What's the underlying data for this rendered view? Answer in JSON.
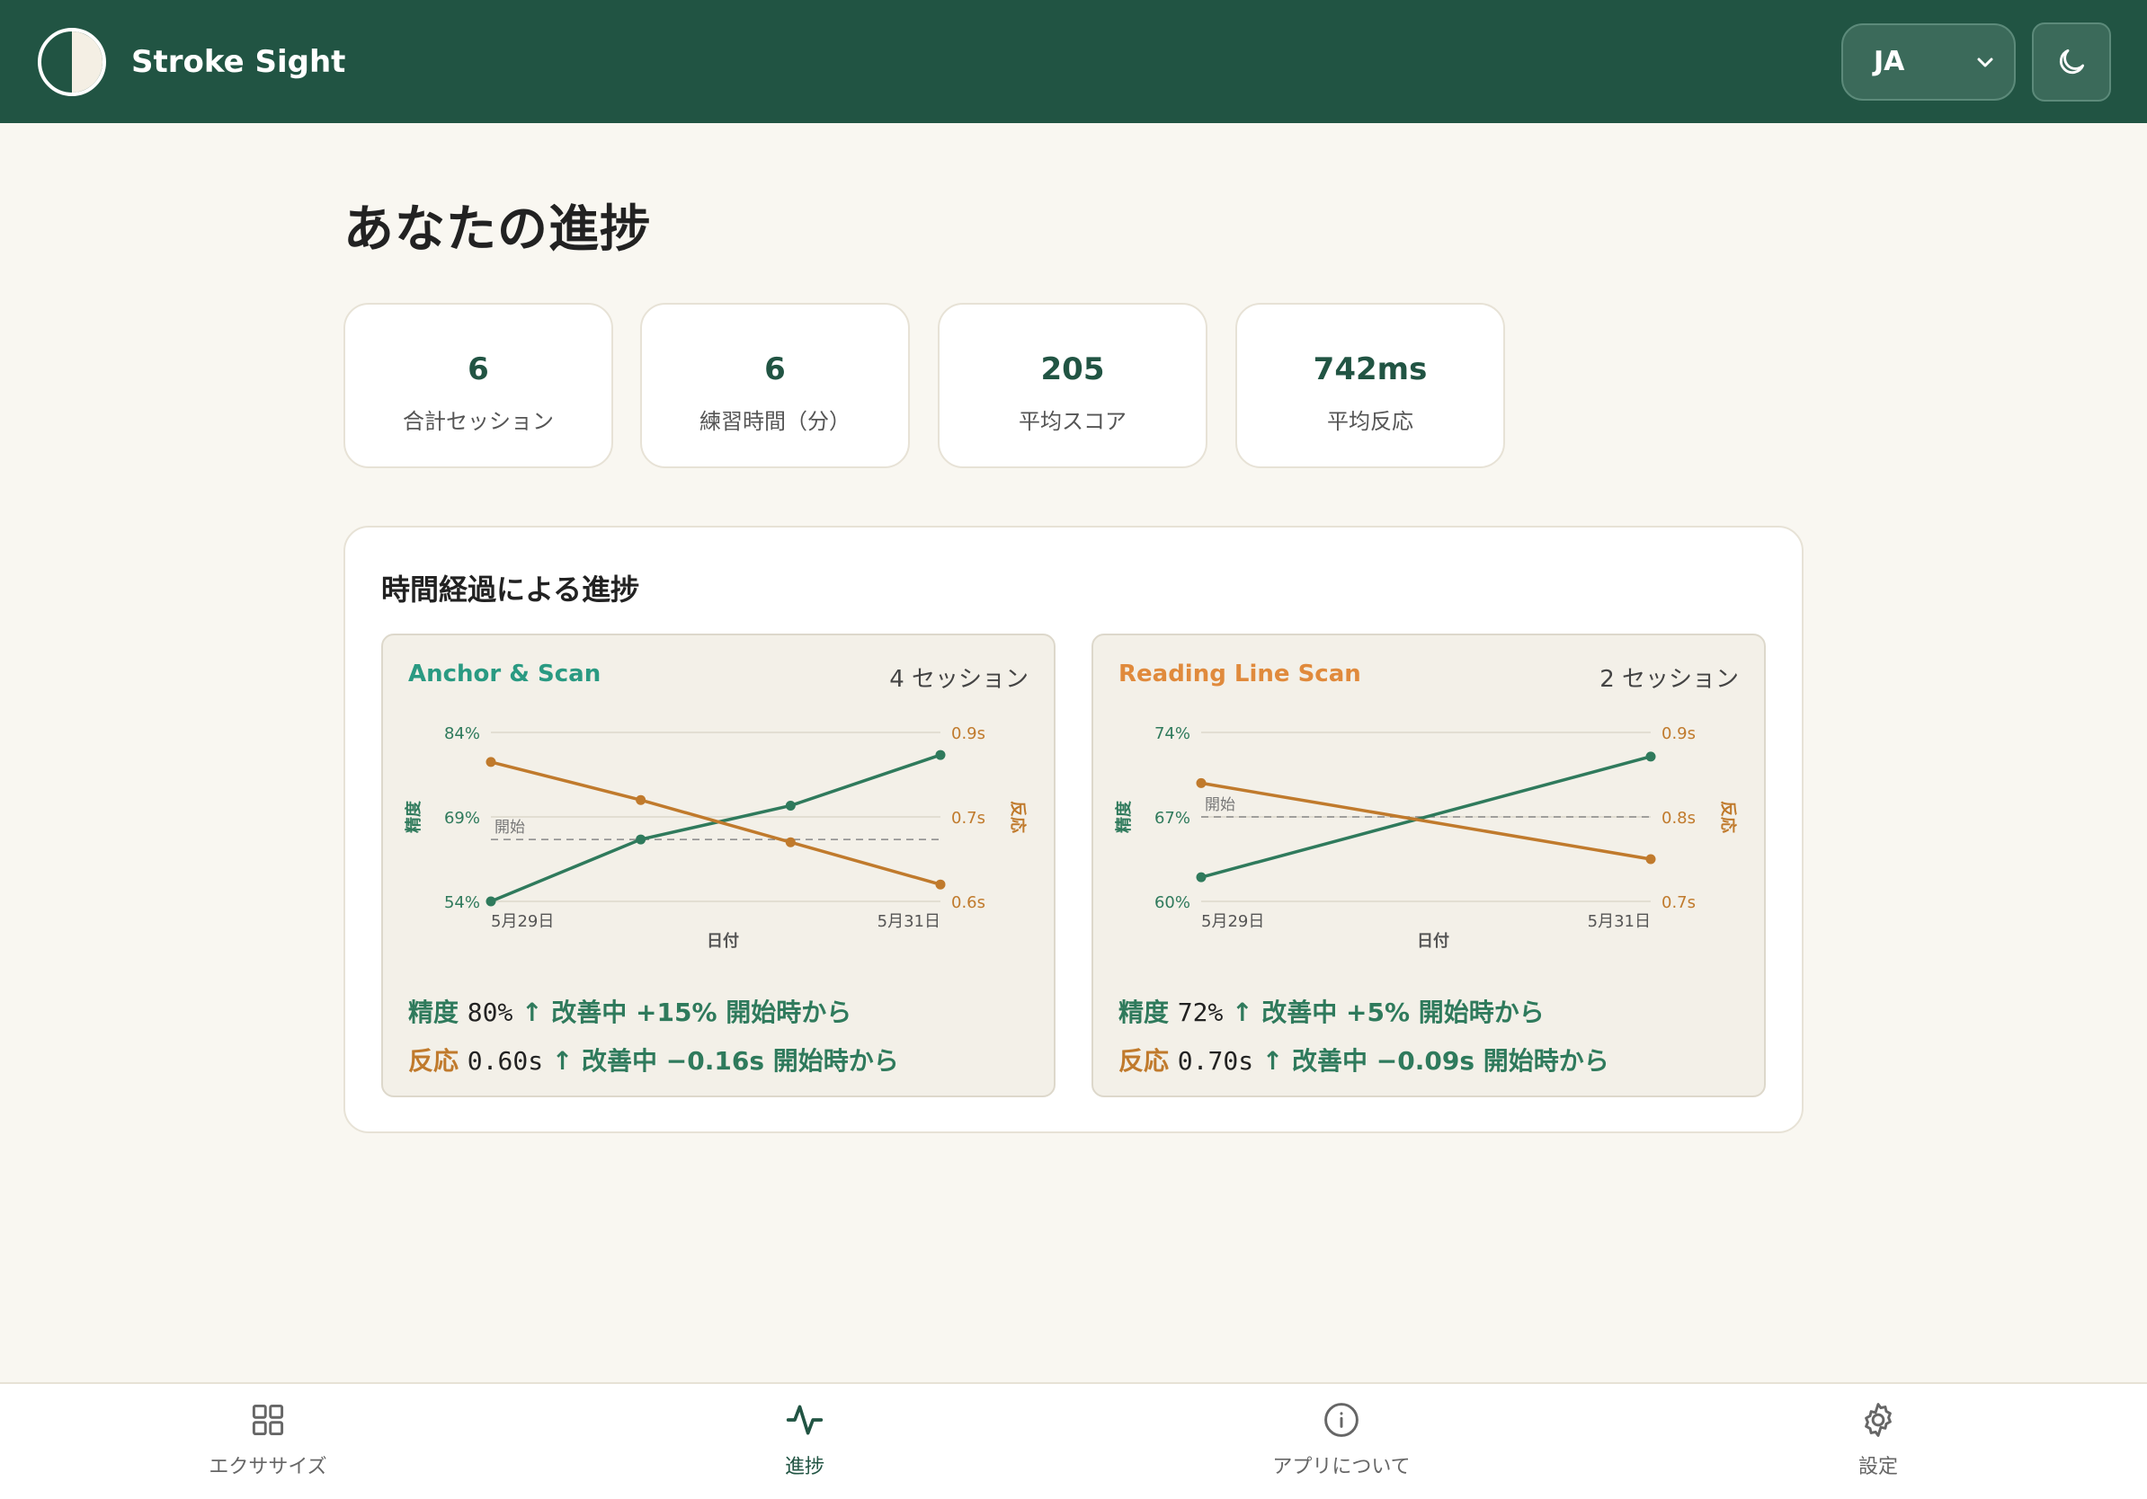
{
  "app": {
    "name": "Stroke Sight"
  },
  "header": {
    "language": "JA"
  },
  "page": {
    "title": "あなたの進捗"
  },
  "stats": [
    {
      "value": "6",
      "label": "合計セッション"
    },
    {
      "value": "6",
      "label": "練習時間（分）"
    },
    {
      "value": "205",
      "label": "平均スコア"
    },
    {
      "value": "742ms",
      "label": "平均反応"
    }
  ],
  "progress": {
    "title": "時間経過による進捗",
    "exercises": [
      {
        "name": "Anchor & Scan",
        "sessions": "4 セッション",
        "accuracy_text": "80%",
        "accuracy_trend": "↑ 改善中 +15% 開始時から",
        "reaction_text": "0.60s",
        "reaction_trend": "↑ 改善中 −0.16s 開始時から"
      },
      {
        "name": "Reading Line Scan",
        "sessions": "2 セッション",
        "accuracy_text": "72%",
        "accuracy_trend": "↑ 改善中 +5% 開始時から",
        "reaction_text": "0.70s",
        "reaction_trend": "↑ 改善中 −0.09s 開始時から"
      }
    ],
    "labels": {
      "accuracy": "精度",
      "reaction": "反応",
      "date_axis": "日付",
      "start": "開始"
    }
  },
  "chart_data": [
    {
      "type": "line",
      "x": [
        "5月29日",
        "",
        "",
        "5月31日"
      ],
      "xlabel": "日付",
      "y_left_label": "精度",
      "y_right_label": "反応",
      "y_left_ticks": [
        "84%",
        "69%",
        "54%"
      ],
      "y_right_ticks": [
        "0.9s",
        "0.7s",
        "0.6s"
      ],
      "ylim_left": [
        54,
        84
      ],
      "ylim_right": [
        0.56,
        0.96
      ],
      "baseline_label": "開始",
      "baseline_value": 65,
      "legend": [
        "精度",
        "反応"
      ],
      "series": [
        {
          "name": "精度",
          "axis": "left",
          "color": "#2f7a5c",
          "values": [
            54,
            65,
            71,
            80
          ]
        },
        {
          "name": "反応",
          "axis": "right",
          "color": "#c07a2c",
          "values": [
            0.89,
            0.8,
            0.7,
            0.6
          ]
        }
      ]
    },
    {
      "type": "line",
      "x": [
        "5月29日",
        "5月31日"
      ],
      "xlabel": "日付",
      "y_left_label": "精度",
      "y_right_label": "反応",
      "y_left_ticks": [
        "74%",
        "67%",
        "60%"
      ],
      "y_right_ticks": [
        "0.9s",
        "0.8s",
        "0.7s"
      ],
      "ylim_left": [
        60,
        74
      ],
      "ylim_right": [
        0.65,
        0.85
      ],
      "baseline_label": "開始",
      "baseline_value": 67,
      "legend": [
        "精度",
        "反応"
      ],
      "series": [
        {
          "name": "精度",
          "axis": "left",
          "color": "#2f7a5c",
          "values": [
            62,
            72
          ]
        },
        {
          "name": "反応",
          "axis": "right",
          "color": "#c07a2c",
          "values": [
            0.79,
            0.7
          ]
        }
      ]
    }
  ],
  "colors": {
    "brand": "#215443",
    "accuracy": "#2f7a5c",
    "reaction": "#c07a2c",
    "exercise1": "#2a9a82",
    "exercise2": "#e08a3c"
  },
  "nav": [
    {
      "icon": "grid-icon",
      "label": "エクササイズ"
    },
    {
      "icon": "activity-icon",
      "label": "進捗"
    },
    {
      "icon": "info-icon",
      "label": "アプリについて"
    },
    {
      "icon": "gear-icon",
      "label": "設定"
    }
  ]
}
